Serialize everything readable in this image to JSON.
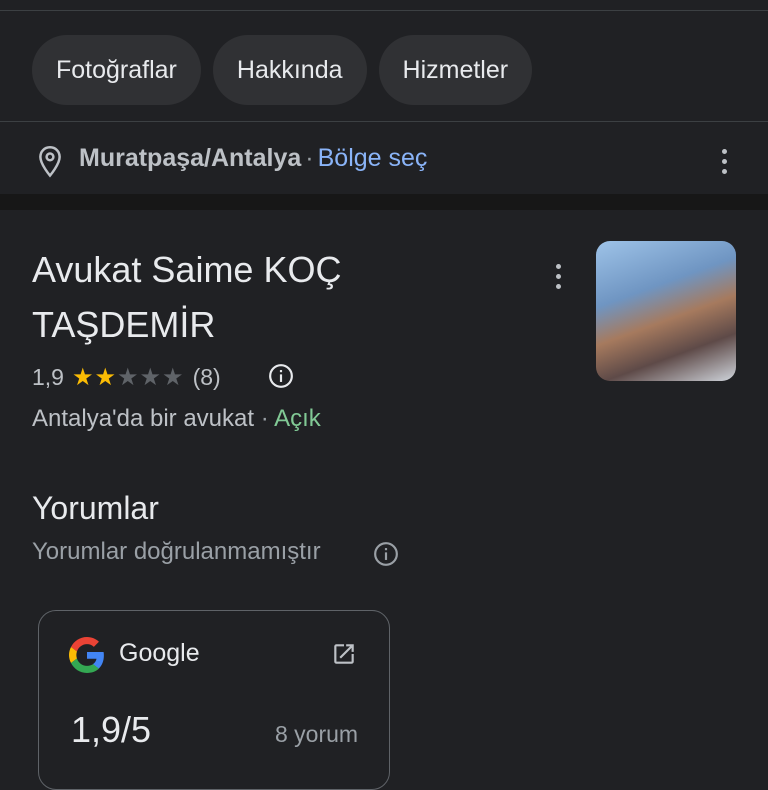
{
  "tabs": [
    {
      "label": "Fotoğraflar"
    },
    {
      "label": "Hakkında"
    },
    {
      "label": "Hizmetler"
    }
  ],
  "location": {
    "place": "Muratpaşa/Antalya",
    "separator": "·",
    "change_label": "Bölge seç",
    "icon": "location-pin-icon"
  },
  "listing": {
    "title_line1": "Avukat Saime KOÇ",
    "title_line2": "TAŞDEMİR",
    "rating": "1,9",
    "rating_value": 1.9,
    "max_stars": 5,
    "review_count": "(8)",
    "category": "Antalya'da bir avukat",
    "separator": "·",
    "status": "Açık"
  },
  "reviews": {
    "heading": "Yorumlar",
    "subtitle": "Yorumlar doğrulanmamıştır",
    "source_card": {
      "source": "Google",
      "score": "1,9/5",
      "count": "8 yorum"
    }
  },
  "colors": {
    "background": "#202124",
    "link": "#8ab4f8",
    "open_status": "#81c995",
    "star": "#fbbc04"
  }
}
